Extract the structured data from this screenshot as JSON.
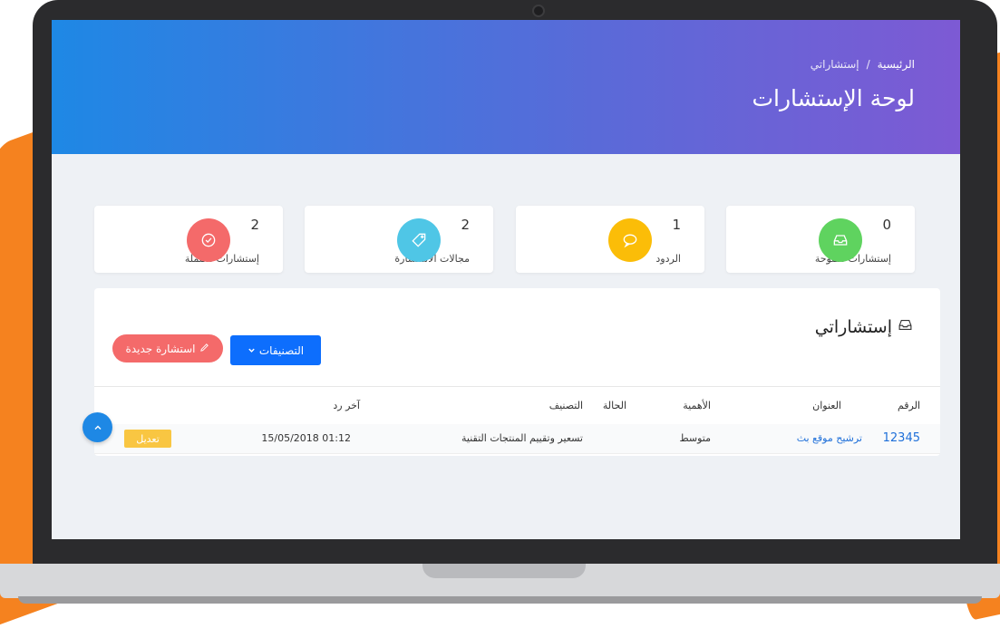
{
  "breadcrumb": {
    "home": "الرئيسية",
    "separator": "/",
    "current": "إستشاراتي"
  },
  "page_title": "لوحة الإستشارات",
  "stats": [
    {
      "value": "0",
      "label": "إستشارات مفتوحة",
      "color": "#5fd35f",
      "icon": "inbox-icon"
    },
    {
      "value": "1",
      "label": "الردود",
      "color": "#fbbd08",
      "icon": "chat-bubble-icon"
    },
    {
      "value": "2",
      "label": "مجالات الاستشارة",
      "color": "#4fc6e6",
      "icon": "tag-icon"
    },
    {
      "value": "2",
      "label": "إستشارات مكتملة",
      "color": "#f46a6a",
      "icon": "check-circle-icon"
    }
  ],
  "panel": {
    "title": "إستشاراتي",
    "categories_button": "التصنيفات",
    "new_button": "استشارة جديدة"
  },
  "table": {
    "headers": {
      "id": "الرقم",
      "title": "العنوان",
      "importance": "الأهمية",
      "status": "الحالة",
      "category": "التصنيف",
      "last_reply": "آخر رد"
    },
    "rows": [
      {
        "id": "12345",
        "title": "ترشيح موقع بث",
        "importance": "متوسط",
        "status": "",
        "category": "تسعير وتقييم المنتجات التقنية",
        "last_reply": "15/05/2018 01:12",
        "action": "تعديل"
      }
    ]
  },
  "colors": {
    "primary": "#0d6efd",
    "danger": "#f46a6a",
    "warning": "#f9c642",
    "accent_orange": "#f5821f"
  }
}
